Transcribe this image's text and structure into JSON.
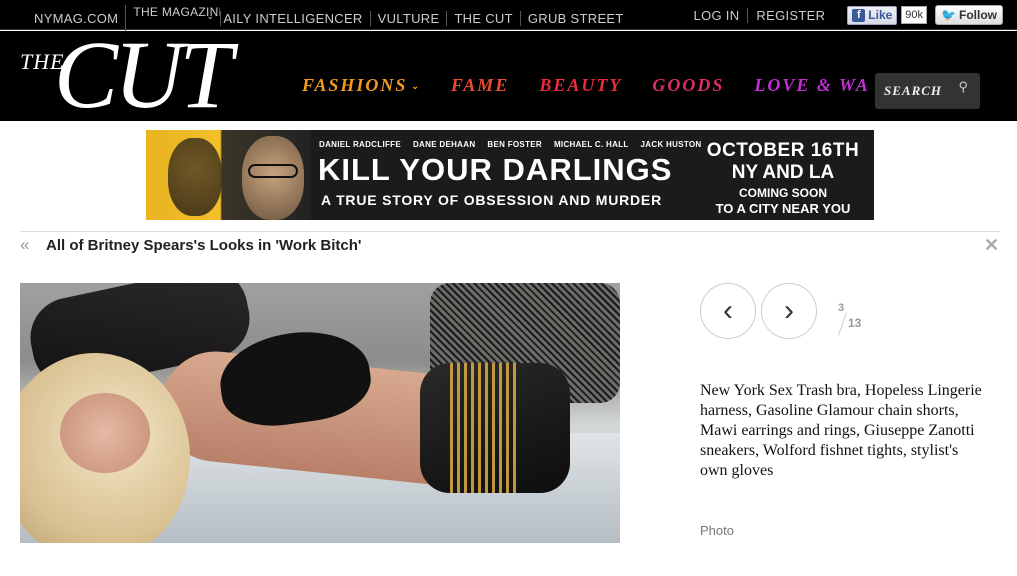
{
  "topbar": {
    "sites": [
      "NYMAG.COM",
      "THE MAGAZINE",
      "AILY INTELLIGENCER",
      "VULTURE",
      "THE CUT",
      "GRUB STREET"
    ],
    "account": [
      "LOG IN",
      "REGISTER"
    ],
    "fb_like_label": "Like",
    "fb_like_count": "90k",
    "tw_follow_label": "Follow"
  },
  "masthead": {
    "logo_the": "THE",
    "logo_cut": "CUT",
    "nav": [
      {
        "label": "FASHIONS",
        "color": "#f39a1d"
      },
      {
        "label": "FAME",
        "color": "#ec4a2d"
      },
      {
        "label": "BEAUTY",
        "color": "#ea2b3c"
      },
      {
        "label": "GOODS",
        "color": "#e02b63"
      },
      {
        "label": "LOVE & WA",
        "color": "#c42ed2"
      }
    ],
    "search_label": "SEARCH"
  },
  "ad": {
    "names": [
      "DANIEL RADCLIFFE",
      "DANE DEHAAN",
      "BEN FOSTER",
      "MICHAEL C. HALL",
      "JACK HUSTON"
    ],
    "headline": "KILL YOUR DARLINGS",
    "tagline": "A TRUE STORY OF OBSESSION AND MURDER",
    "date": "OCTOBER 16TH",
    "cities": "NY AND LA",
    "coming": "COMING SOON",
    "near": "TO A CITY NEAR YOU"
  },
  "slideshow": {
    "title": "All of Britney Spears's Looks in 'Work Bitch'",
    "current": "3",
    "total": "13",
    "caption": "New York Sex Trash bra, Hopeless Lingerie harness, Gasoline Glamour chain shorts, Mawi earrings and rings, Giuseppe Zanotti sneakers, Wolford fishnet tights, stylist's own gloves",
    "credit": "Photo"
  }
}
